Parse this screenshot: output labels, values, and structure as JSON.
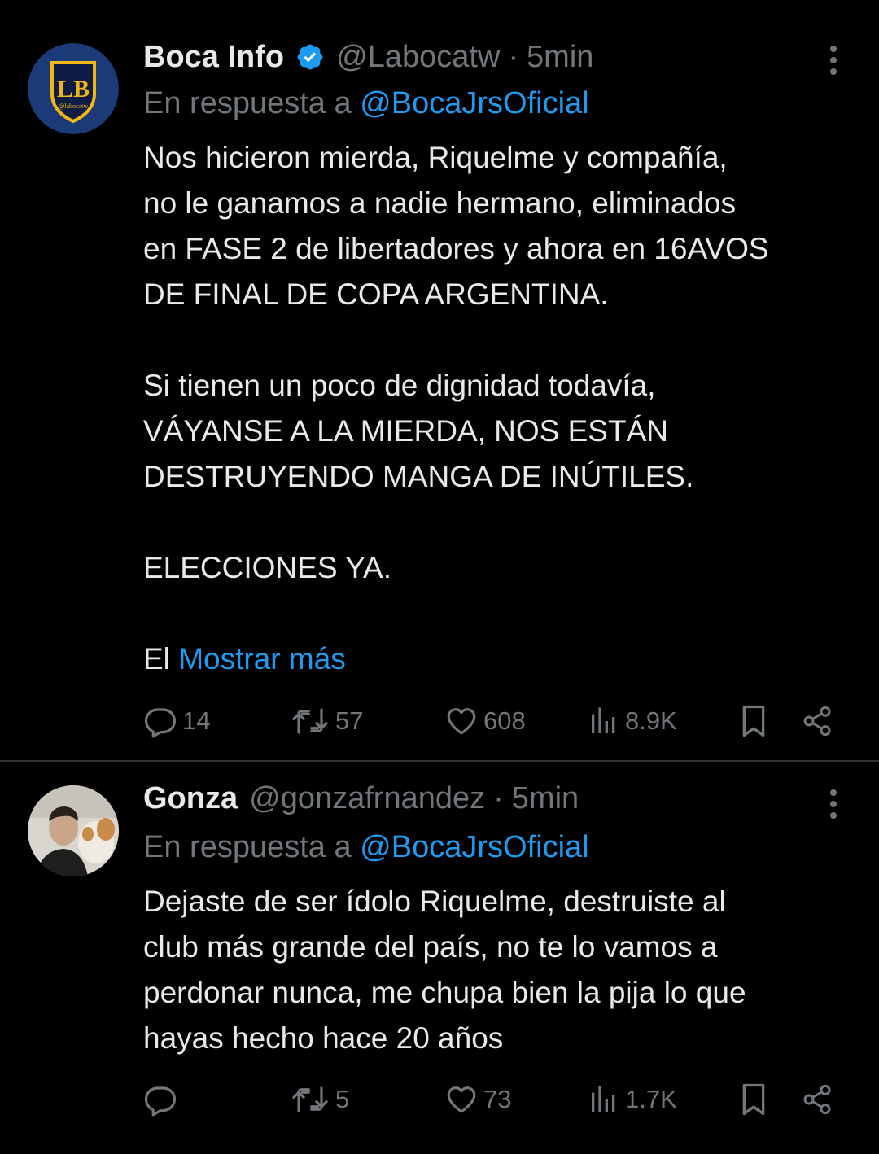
{
  "tweets": [
    {
      "author": "Boca Info",
      "handle": "@Labocatw",
      "separator": "·",
      "time": "5min",
      "reply_prefix": "En respuesta a",
      "reply_to": "@BocaJrsOficial",
      "avatar_text": "LB",
      "avatar_subtext": "@labocatw",
      "verified": true,
      "text": "Nos hicieron mierda, Riquelme y compañía,\nno le ganamos a nadie hermano, eliminados\nen FASE 2 de libertadores y ahora en 16AVOS\nDE FINAL DE COPA ARGENTINA.\n\nSi tienen un poco de dignidad todavía,\nVÁYANSE A LA MIERDA, NOS ESTÁN\nDESTRUYENDO MANGA DE INÚTILES.\n\nELECCIONES YA.",
      "truncated_text": "El",
      "show_more": "Mostrar más",
      "stats": {
        "replies": "14",
        "retweets": "57",
        "likes": "608",
        "views": "8.9K"
      }
    },
    {
      "author": "Gonza",
      "handle": "@gonzafrnandez",
      "separator": "·",
      "time": "5min",
      "reply_prefix": "En respuesta a",
      "reply_to": "@BocaJrsOficial",
      "verified": false,
      "text": "Dejaste de ser ídolo Riquelme, destruiste al\nclub más grande del país, no te lo vamos a\nperdonar nunca, me chupa bien la pija lo que\nhayas hecho hace 20 años",
      "stats": {
        "replies": "",
        "retweets": "5",
        "likes": "73",
        "views": "1.7K"
      }
    }
  ],
  "colors": {
    "background": "#000000",
    "text_primary": "#e7e9ea",
    "text_secondary": "#71767b",
    "accent": "#1d9bf0",
    "divider": "#2f3336"
  },
  "icons": [
    "verified-icon",
    "more-icon",
    "reply-icon",
    "retweet-icon",
    "like-icon",
    "views-icon",
    "bookmark-icon",
    "share-icon"
  ]
}
